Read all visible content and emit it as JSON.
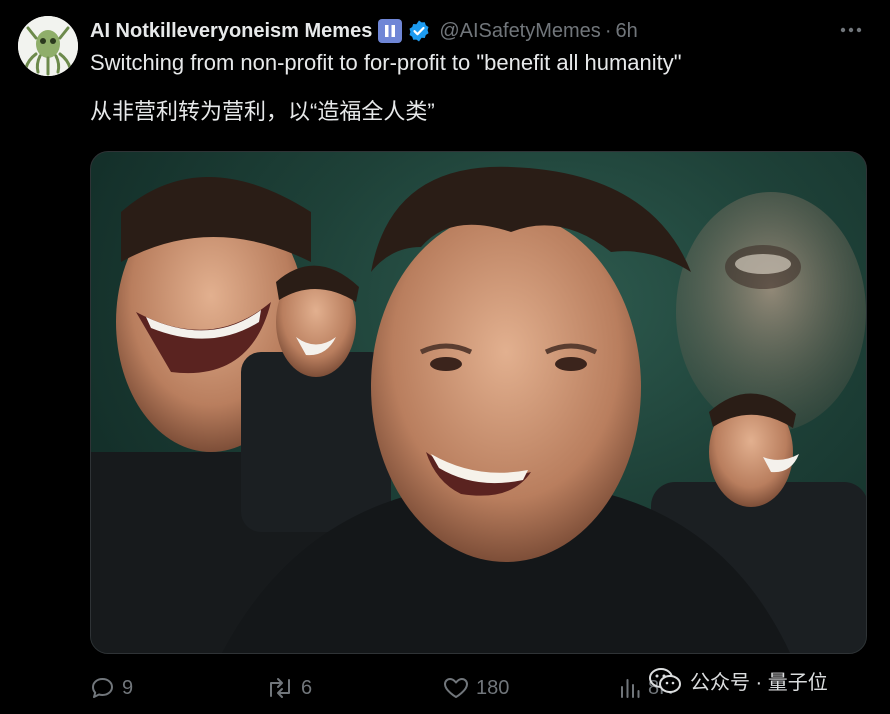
{
  "post": {
    "author_name": "AI Notkilleveryoneism Memes",
    "handle": "@AISafetyMemes",
    "separator": "·",
    "time": "6h",
    "text_en": "Switching from non-profit to for-profit to \"benefit all humanity\"",
    "text_zh": "从非营利转为营利，以“造福全人类”"
  },
  "icons": {
    "more": "more-icon",
    "pause_badge": "pause-badge-icon",
    "verified": "verified-badge-icon"
  },
  "actions": {
    "replies": "9",
    "reposts": "6",
    "likes": "180",
    "views": "8K"
  },
  "watermark": {
    "label": "公众号 · 量子位"
  },
  "colors": {
    "background": "#000000",
    "primary_text": "#e7e9ea",
    "secondary_text": "#71767b",
    "verified_blue": "#1d9bf0",
    "pause_badge": "#6f86d6",
    "image_backdrop": "#1e4138"
  }
}
